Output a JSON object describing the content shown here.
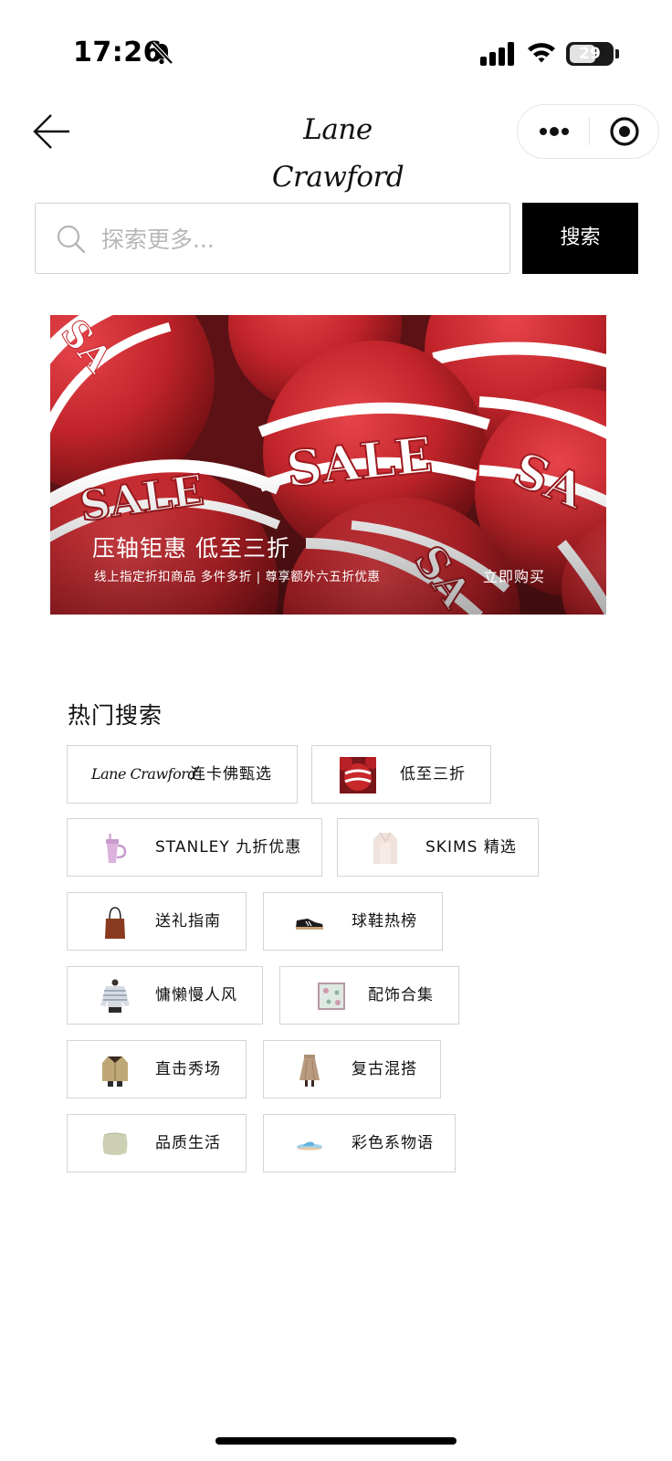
{
  "status_bar": {
    "time": "17:26",
    "battery": "29",
    "icons": [
      "bell-slash-icon",
      "cellular-signal-icon",
      "wifi-icon",
      "battery-icon"
    ]
  },
  "nav": {
    "back_icon": "arrow-left-icon",
    "logo": "Lane Crawford",
    "more_icon": "more-dots-icon",
    "close_icon": "target-circle-icon"
  },
  "search": {
    "placeholder": "探索更多...",
    "button_label": "搜索",
    "icon": "search-icon"
  },
  "banner": {
    "image_text": "SALE",
    "title": "压轴钜惠 低至三折",
    "subtitle": "线上指定折扣商品 多件多折 | 尊享额外六五折优惠",
    "cta": "立即购买"
  },
  "hot_search": {
    "title": "热门搜索",
    "items": [
      {
        "label": "连卡佛甄选",
        "logo_text": "Lane Crawford",
        "thumb": "lane-crawford-logo"
      },
      {
        "label": "低至三折",
        "thumb": "sale-ball-thumb"
      },
      {
        "label": "STANLEY 九折优惠",
        "thumb": "tumbler-thumb"
      },
      {
        "label": "SKIMS 精选",
        "thumb": "cardigan-thumb"
      },
      {
        "label": "送礼指南",
        "thumb": "handbag-thumb"
      },
      {
        "label": "球鞋热榜",
        "thumb": "sneaker-thumb"
      },
      {
        "label": "慵懒慢人风",
        "thumb": "knit-sweater-thumb"
      },
      {
        "label": "配饰合集",
        "thumb": "scarf-thumb"
      },
      {
        "label": "直击秀场",
        "thumb": "jacket-thumb"
      },
      {
        "label": "复古混搭",
        "thumb": "skirt-thumb"
      },
      {
        "label": "品质生活",
        "thumb": "pillow-thumb"
      },
      {
        "label": "彩色系物语",
        "thumb": "slipper-thumb"
      }
    ]
  },
  "colors": {
    "brand_black": "#000000",
    "sale_red": "#c8282a",
    "chip_border": "#d4d4d4"
  }
}
